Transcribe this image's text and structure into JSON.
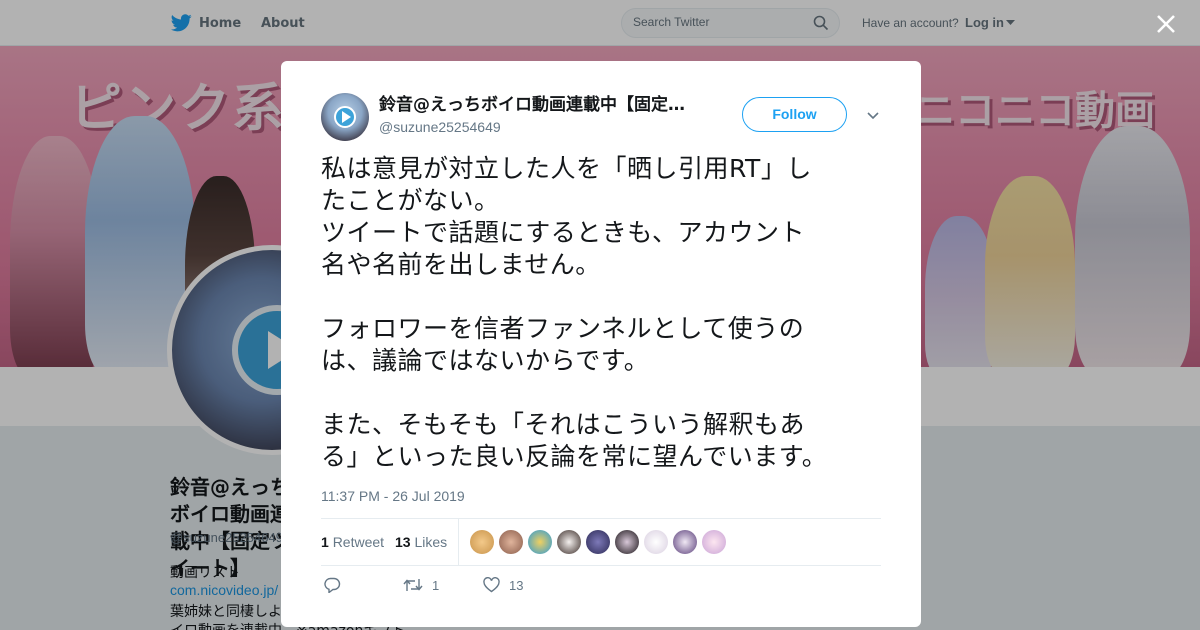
{
  "nav": {
    "home_label": "Home",
    "about_label": "About",
    "search_placeholder": "Search Twitter",
    "account_question": "Have an account?",
    "login_label": "Log in"
  },
  "banner": {
    "text_left": "ピンク系",
    "text_right": "ニコニコ動画"
  },
  "profile": {
    "name": "鈴音@えっちボイロ動画連載中【固定ツイート】",
    "handle": "@suzune25254649",
    "bio_line1": "動画リスト",
    "bio_link": "com.nicovideo.jp/",
    "bio_line2": "葉姉妹と同棲しよ",
    "bio_line3": "イロ動画を連載中。※amazonギフト"
  },
  "tweet": {
    "author_name": "鈴音@えっちボイロ動画連載中【固定ツイート】",
    "author_handle": "@suzune25254649",
    "follow_label": "Follow",
    "text_lines": [
      "私は意見が対立した人を「晒し引用RT」し",
      "たことがない。",
      "ツイートで話題にするときも、アカウント",
      "名や名前を出しません。",
      "",
      "フォロワーを信者ファンネルとして使うの",
      "は、議論ではないからです。",
      "",
      "また、そもそも「それはこういう解釈もあ",
      "る」といった良い反論を常に望んでいます。"
    ],
    "timestamp": "11:37 PM - 26 Jul 2019",
    "retweet_count": "1",
    "retweet_label": "Retweet",
    "like_count": "13",
    "like_label": "Likes",
    "action_retweet_count": "1",
    "action_like_count": "13"
  },
  "colors": {
    "accent": "#1da1f2",
    "muted": "#657786",
    "text": "#14171a"
  },
  "icons": {
    "logo": "twitter-bird-icon",
    "search": "search-icon",
    "close": "close-icon",
    "reply": "reply-icon",
    "retweet": "retweet-icon",
    "like": "heart-icon",
    "caret": "chevron-down-icon"
  }
}
